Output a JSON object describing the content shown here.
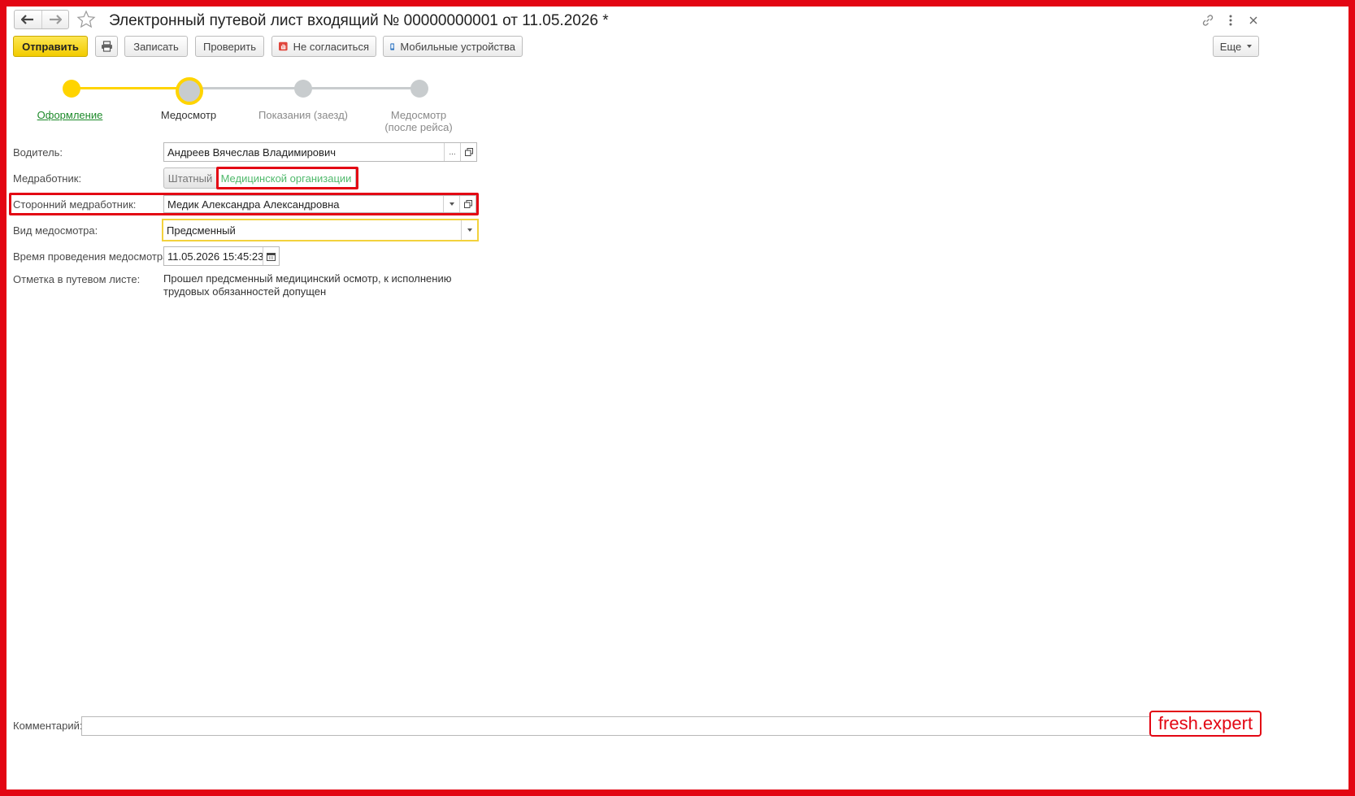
{
  "window": {
    "title": "Электронный путевой лист входящий № 00000000001 от 11.05.2026 *"
  },
  "toolbar": {
    "send_label": "Отправить",
    "save_label": "Записать",
    "check_label": "Проверить",
    "disagree_label": "Не согласиться",
    "mobile_label": "Мобильные устройства",
    "more_label": "Еще"
  },
  "steps": [
    {
      "label": "Оформление",
      "state": "done"
    },
    {
      "label": "Медосмотр",
      "state": "current"
    },
    {
      "label": "Показания (заезд)",
      "state": "pending"
    },
    {
      "label": "Медосмотр\n(после рейса)",
      "state": "pending"
    }
  ],
  "form": {
    "driver_label": "Водитель:",
    "driver_value": "Андреев Вячеслав Владимирович",
    "medworker_label": "Медработник:",
    "medworker_options": [
      "Штатный",
      "Медицинской организации"
    ],
    "medworker_selected": "Медицинской организации",
    "external_medworker_label": "Сторонний медработник:",
    "external_medworker_value": "Медик Александра Александровна",
    "exam_type_label": "Вид медосмотра:",
    "exam_type_value": "Предсменный",
    "exam_time_label": "Время проведения медосмотра:",
    "exam_time_value": "11.05.2026 15:45:23",
    "note_label": "Отметка в путевом листе:",
    "note_text": "Прошел предсменный медицинский осмотр, к исполнению трудовых обязанностей допущен"
  },
  "footer": {
    "comment_label": "Комментарий:",
    "comment_value": ""
  },
  "watermark": "fresh.expert",
  "colors": {
    "accent_yellow": "#ffd400",
    "highlight_red": "#e30613",
    "link_green": "#1d8a2a",
    "pending_gray": "#8a8a8a"
  }
}
